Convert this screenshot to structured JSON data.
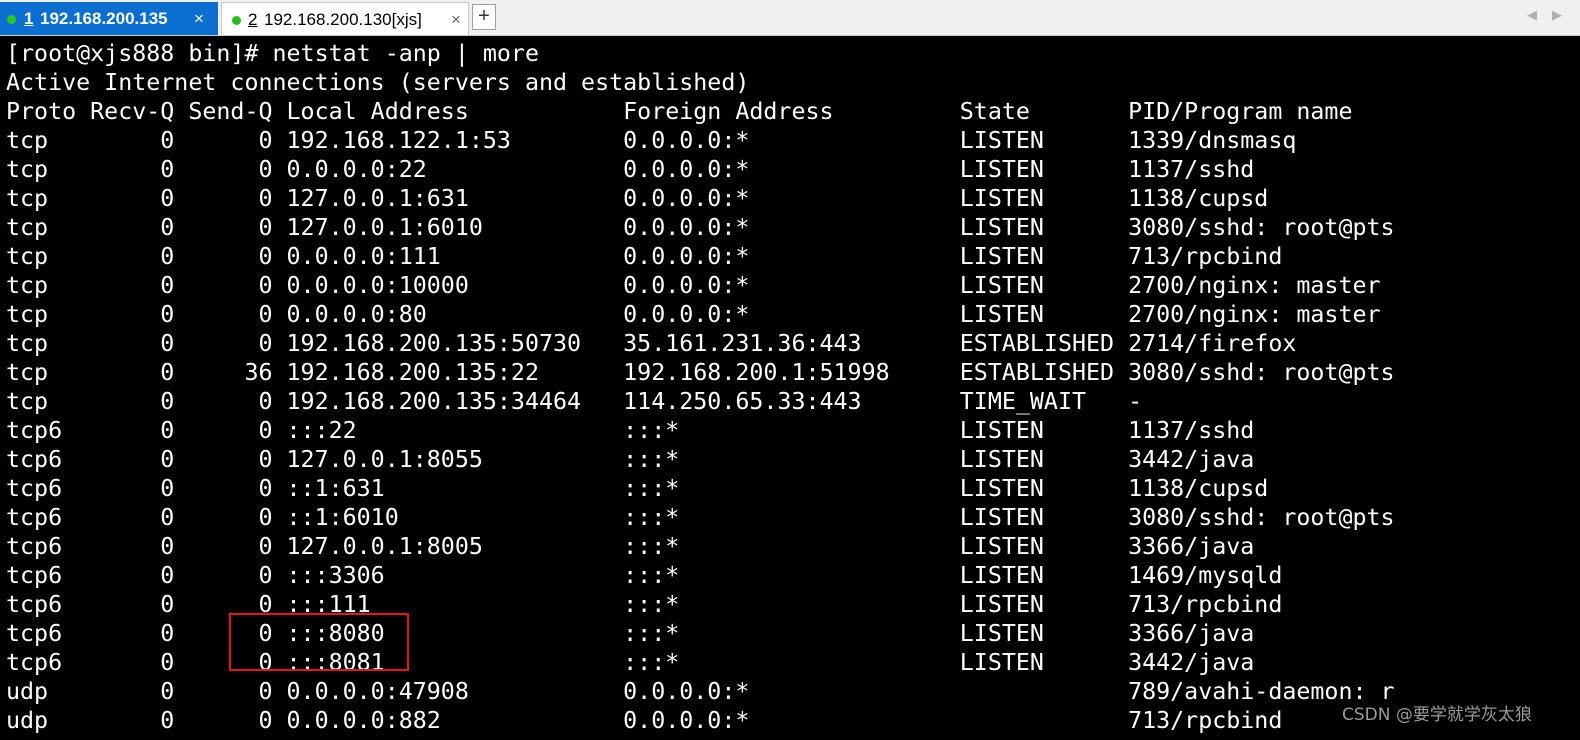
{
  "tabs": [
    {
      "number": "1",
      "title": "192.168.200.135",
      "close": "×",
      "active": true
    },
    {
      "number": "2",
      "title": "192.168.200.130[xjs]",
      "close": "×",
      "active": false
    }
  ],
  "new_tab_label": "+",
  "nav": {
    "left_arrow": "◀",
    "right_arrow": "▶"
  },
  "colors": {
    "active_tab": "#0a6fd1",
    "status_dot": "#22cc22",
    "terminal_bg": "#000000",
    "terminal_fg": "#ffffff",
    "highlight_box": "#e01818"
  },
  "terminal": {
    "lines": [
      "[root@xjs888 bin]# netstat -anp | more",
      "Active Internet connections (servers and established)",
      "Proto Recv-Q Send-Q Local Address           Foreign Address         State       PID/Program name",
      "tcp        0      0 192.168.122.1:53        0.0.0.0:*               LISTEN      1339/dnsmasq",
      "tcp        0      0 0.0.0.0:22              0.0.0.0:*               LISTEN      1137/sshd",
      "tcp        0      0 127.0.0.1:631           0.0.0.0:*               LISTEN      1138/cupsd",
      "tcp        0      0 127.0.0.1:6010          0.0.0.0:*               LISTEN      3080/sshd: root@pts",
      "tcp        0      0 0.0.0.0:111             0.0.0.0:*               LISTEN      713/rpcbind",
      "tcp        0      0 0.0.0.0:10000           0.0.0.0:*               LISTEN      2700/nginx: master",
      "tcp        0      0 0.0.0.0:80              0.0.0.0:*               LISTEN      2700/nginx: master",
      "tcp        0      0 192.168.200.135:50730   35.161.231.36:443       ESTABLISHED 2714/firefox",
      "tcp        0     36 192.168.200.135:22      192.168.200.1:51998     ESTABLISHED 3080/sshd: root@pts",
      "tcp        0      0 192.168.200.135:34464   114.250.65.33:443       TIME_WAIT   -",
      "tcp6       0      0 :::22                   :::*                    LISTEN      1137/sshd",
      "tcp6       0      0 127.0.0.1:8055          :::*                    LISTEN      3442/java",
      "tcp6       0      0 ::1:631                 :::*                    LISTEN      1138/cupsd",
      "tcp6       0      0 ::1:6010                :::*                    LISTEN      3080/sshd: root@pts",
      "tcp6       0      0 127.0.0.1:8005          :::*                    LISTEN      3366/java",
      "tcp6       0      0 :::3306                 :::*                    LISTEN      1469/mysqld",
      "tcp6       0      0 :::111                  :::*                    LISTEN      713/rpcbind",
      "tcp6       0      0 :::8080                 :::*                    LISTEN      3366/java",
      "tcp6       0      0 :::8081                 :::*                    LISTEN      3442/java",
      "udp        0      0 0.0.0.0:47908           0.0.0.0:*                           789/avahi-daemon: r",
      "udp        0      0 0.0.0.0:882             0.0.0.0:*                           713/rpcbind"
    ]
  },
  "watermark": "CSDN @要学就学灰太狼"
}
